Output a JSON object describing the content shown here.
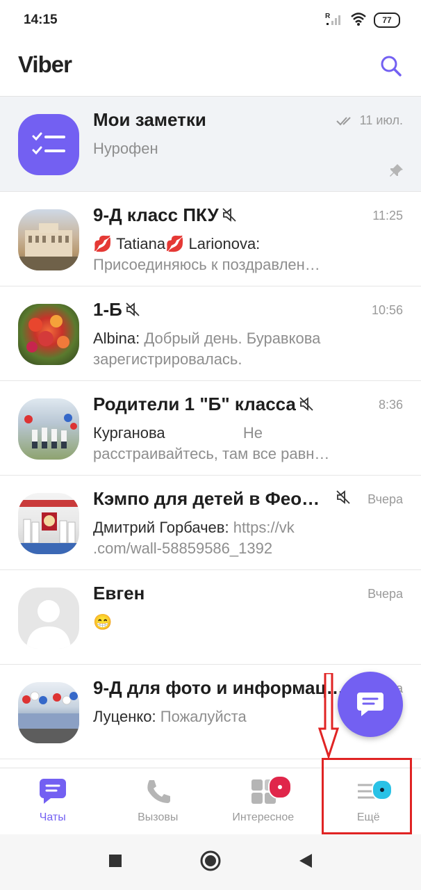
{
  "status_bar": {
    "time": "14:15",
    "battery": "77",
    "signal_label": "R"
  },
  "header": {
    "title": "Viber"
  },
  "chats": [
    {
      "name": "Мои заметки",
      "time": "11 июл.",
      "sender": "",
      "preview": "Нурофен",
      "pinned": true
    },
    {
      "name": "9-Д класс ПКУ",
      "time": "11:25",
      "sender": "💋 Tatiana💋 Larionova:",
      "preview": "Присоединяюсь к поздравлен…",
      "muted": true
    },
    {
      "name": "1-Б",
      "time": "10:56",
      "sender": "Albina:",
      "preview": "Добрый день. Буравкова зарегистрировалась.",
      "muted": true
    },
    {
      "name": "Родители 1 \"Б\" класса",
      "time": "8:36",
      "sender": "Курганова",
      "preview": "Не расстраивайтесь, там все равн…",
      "muted": true
    },
    {
      "name": "Кэмпо для детей в Фео…",
      "time": "Вчера",
      "sender": "Дмитрий Горбачев:",
      "preview": "https://vk .com/wall-58859586_1392",
      "muted": true
    },
    {
      "name": "Евген",
      "time": "Вчера",
      "sender": "",
      "preview": "😁"
    },
    {
      "name": "9-Д для фото и информац…",
      "time": "Вчера",
      "sender": "Луценко:",
      "preview": "Пожалуйста"
    }
  ],
  "tabs": [
    {
      "label": "Чаты",
      "active": true,
      "icon": "chat-bubble-icon"
    },
    {
      "label": "Вызовы",
      "icon": "phone-icon"
    },
    {
      "label": "Интересное",
      "icon": "grid-icon"
    },
    {
      "label": "Ещё",
      "icon": "menu-icon"
    }
  ],
  "colors": {
    "accent": "#7360f2",
    "badge_red": "#e0264a",
    "badge_cyan": "#2ac2e6",
    "annotation": "#e02424"
  }
}
